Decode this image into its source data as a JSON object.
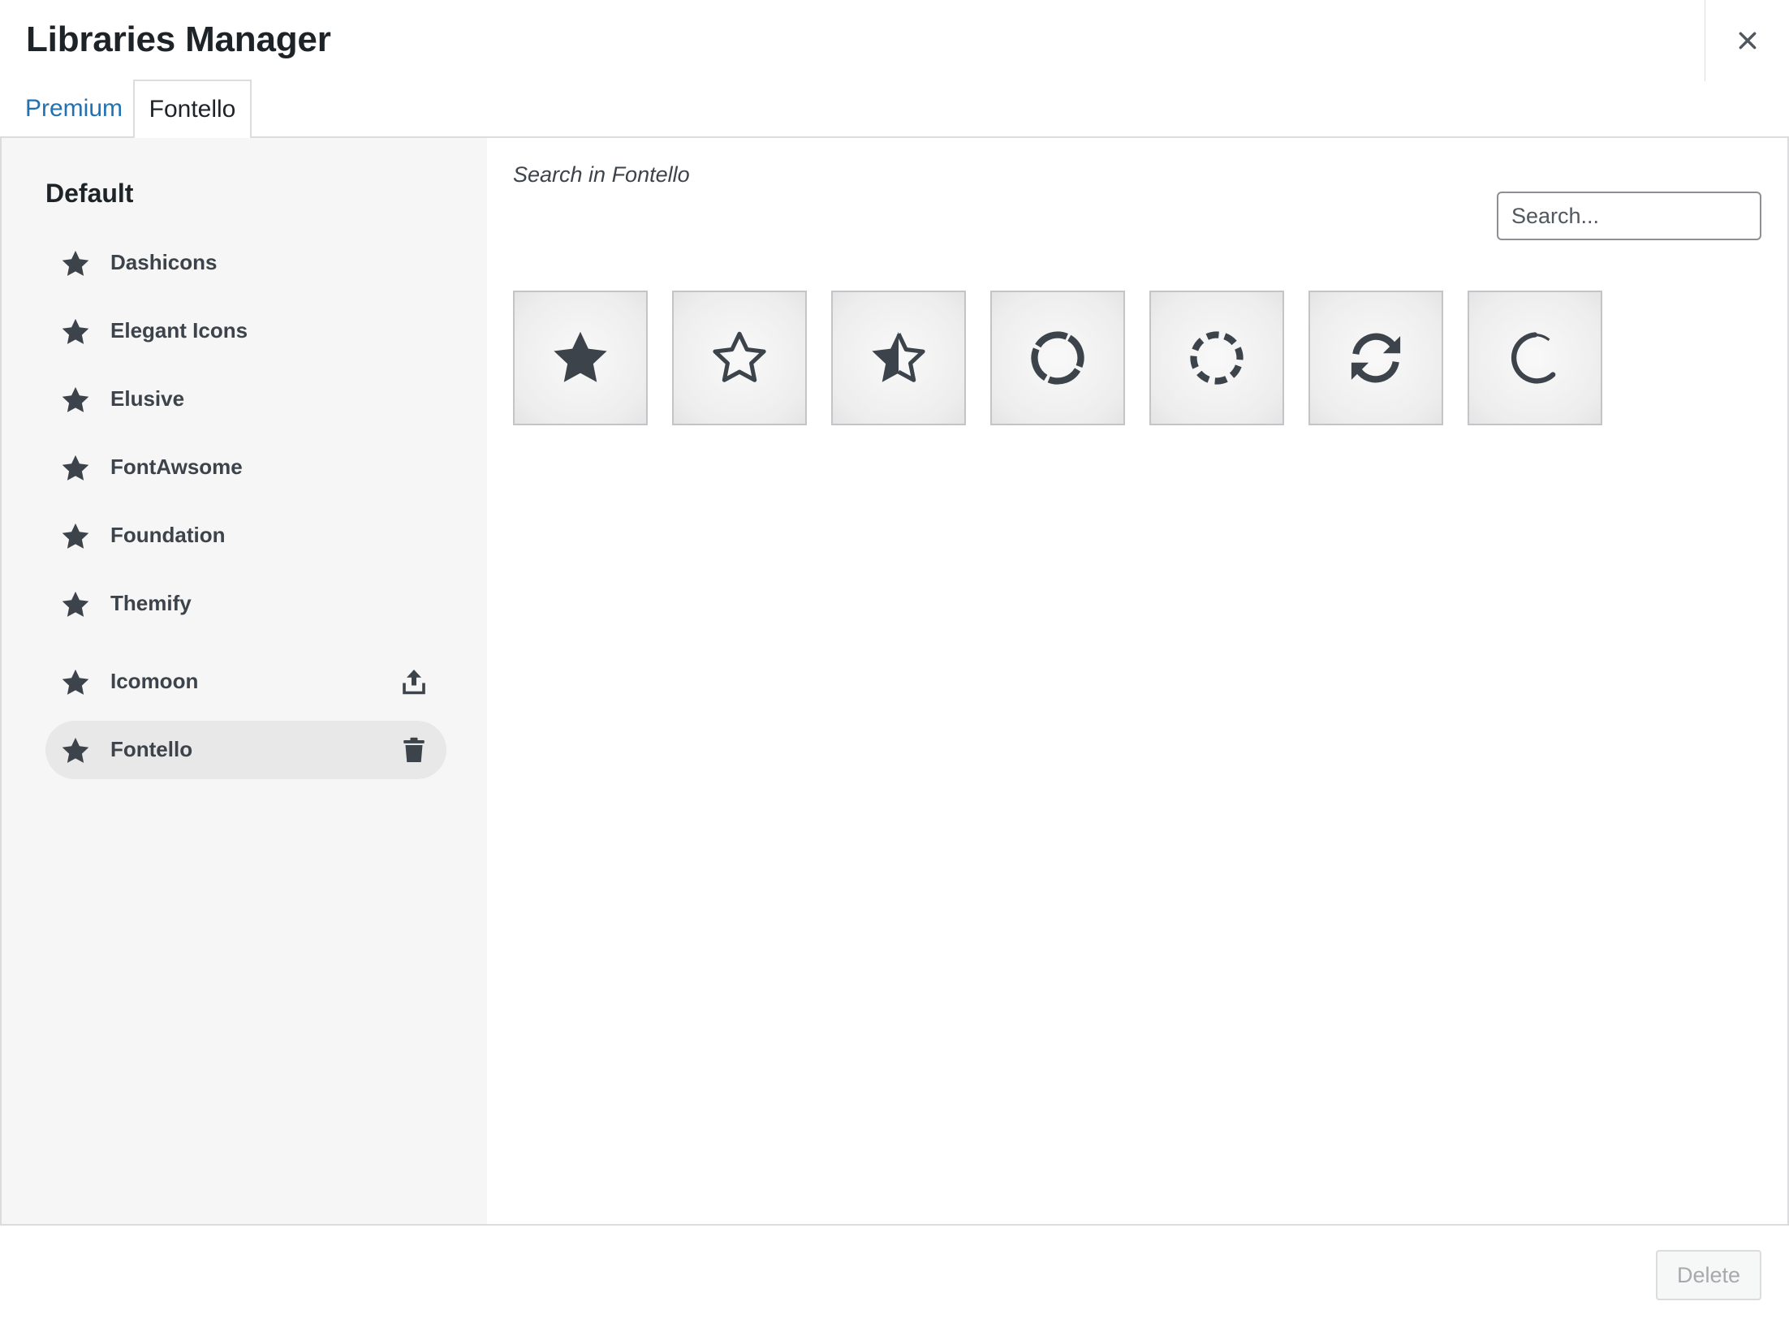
{
  "modal": {
    "title": "Libraries Manager",
    "close_icon": "close-icon"
  },
  "tabs": [
    {
      "label": "Premium",
      "active": false
    },
    {
      "label": "Fontello",
      "active": true
    }
  ],
  "sidebar": {
    "heading": "Default",
    "items": [
      {
        "label": "Dashicons",
        "icon": "star-icon"
      },
      {
        "label": "Elegant Icons",
        "icon": "star-icon"
      },
      {
        "label": "Elusive",
        "icon": "star-icon"
      },
      {
        "label": "FontAwsome",
        "icon": "star-icon"
      },
      {
        "label": "Foundation",
        "icon": "star-icon"
      },
      {
        "label": "Themify",
        "icon": "star-icon"
      }
    ],
    "custom_items": [
      {
        "label": "Icomoon",
        "icon": "star-icon",
        "action_icon": "upload-icon",
        "active": false
      },
      {
        "label": "Fontello",
        "icon": "star-icon",
        "action_icon": "trash-icon",
        "active": true
      }
    ]
  },
  "main": {
    "search_label": "Search in Fontello",
    "search_placeholder": "Search...",
    "icons": [
      "star-filled-icon",
      "star-outline-icon",
      "star-half-icon",
      "spinner-icon",
      "spinner-dashed-icon",
      "refresh-icon",
      "loading-arc-icon"
    ]
  },
  "footer": {
    "delete_label": "Delete"
  },
  "colors": {
    "accent": "#2271b1",
    "icon": "#3c434a",
    "sidebar_bg": "#f5f6f5"
  }
}
